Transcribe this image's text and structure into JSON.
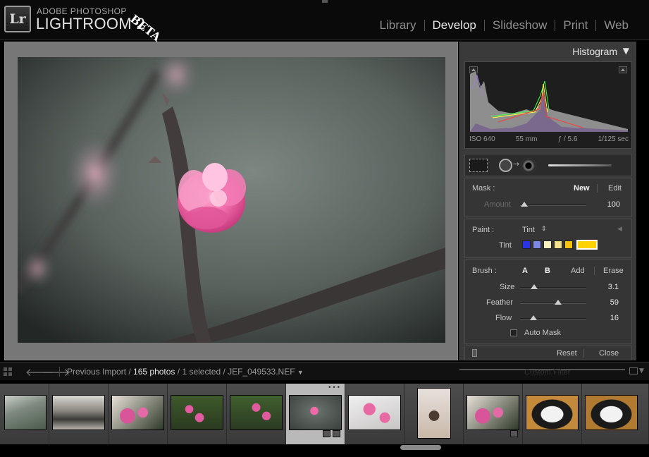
{
  "app": {
    "badge": "Lr",
    "brand_top": "ADOBE PHOTOSHOP",
    "brand_main": "LIGHTROOM 2",
    "beta": "BETA"
  },
  "modules": [
    {
      "label": "Library",
      "active": false
    },
    {
      "label": "Develop",
      "active": true
    },
    {
      "label": "Slideshow",
      "active": false
    },
    {
      "label": "Print",
      "active": false
    },
    {
      "label": "Web",
      "active": false
    }
  ],
  "histogram": {
    "title": "Histogram",
    "iso": "ISO 640",
    "focal": "55 mm",
    "aperture": "ƒ / 5.6",
    "shutter": "1/125 sec"
  },
  "mask": {
    "label": "Mask :",
    "new": "New",
    "edit": "Edit",
    "amount_label": "Amount",
    "amount_value": "100",
    "amount_level": 0.05
  },
  "paint": {
    "label": "Paint :",
    "mode": "Tint",
    "tint_label": "Tint",
    "swatches": [
      "#2b33e6",
      "#7d88e8",
      "#f8f0c0",
      "#f3e28a",
      "#f6c40b"
    ],
    "selected_swatch": "#ffd200"
  },
  "brush": {
    "label": "Brush :",
    "a": "A",
    "b": "B",
    "add": "Add",
    "erase": "Erase",
    "size_label": "Size",
    "size_value": "3.1",
    "size_level": 0.2,
    "feather_label": "Feather",
    "feather_value": "59",
    "feather_level": 0.59,
    "flow_label": "Flow",
    "flow_value": "16",
    "flow_level": 0.18,
    "auto_mask": "Auto Mask"
  },
  "panel_footer": {
    "reset": "Reset",
    "close": "Close"
  },
  "filmstrip_bar": {
    "source": "Previous Import",
    "count": "165 photos",
    "selection": "1 selected",
    "filename": "JEF_049533.NEF",
    "filter": "Custom Filter"
  },
  "colors": {
    "accent_swatch_border": "#ffd200",
    "blossom_pink": "#f06aa8",
    "panel_bg": "#3a3a3a"
  },
  "thumbnails": [
    {
      "name": "temple-gate",
      "colors": [
        "#7f8a80",
        "#4a5a4c",
        "#c9cfc9"
      ],
      "selected": false
    },
    {
      "name": "temple-building",
      "colors": [
        "#8a8680",
        "#3a3a36",
        "#d9d8d2"
      ],
      "selected": false
    },
    {
      "name": "plum-blossom-branch",
      "colors": [
        "#d9559a",
        "#2f3a2a",
        "#e8e0d8"
      ],
      "selected": false
    },
    {
      "name": "pink-blossoms-green",
      "colors": [
        "#e45aa0",
        "#3e5a2a",
        "#2a3a20"
      ],
      "selected": false
    },
    {
      "name": "pink-blossoms-green-2",
      "colors": [
        "#e05a9e",
        "#41602e",
        "#2a3a22"
      ],
      "selected": false
    },
    {
      "name": "single-blossom",
      "colors": [
        "#f06aa8",
        "#3a403c",
        "#6c746e"
      ],
      "selected": true
    },
    {
      "name": "blossom-cluster-white",
      "colors": [
        "#e86aa4",
        "#f0f0f0",
        "#5a4a4a"
      ],
      "selected": false
    },
    {
      "name": "child-portrait",
      "colors": [
        "#c8b8a8",
        "#4a3a30",
        "#e8e0dc"
      ],
      "selected": false
    },
    {
      "name": "plum-blossom-branch-2",
      "colors": [
        "#d9559a",
        "#2f3a2a",
        "#e8e0d8"
      ],
      "selected": false
    },
    {
      "name": "rice-cakes-plate",
      "colors": [
        "#f2f2f2",
        "#1a1a1a",
        "#c28a3a"
      ],
      "selected": false
    },
    {
      "name": "rice-cakes-plate-2",
      "colors": [
        "#f2f2f2",
        "#1a1a1a",
        "#b07a30"
      ],
      "selected": false
    }
  ]
}
